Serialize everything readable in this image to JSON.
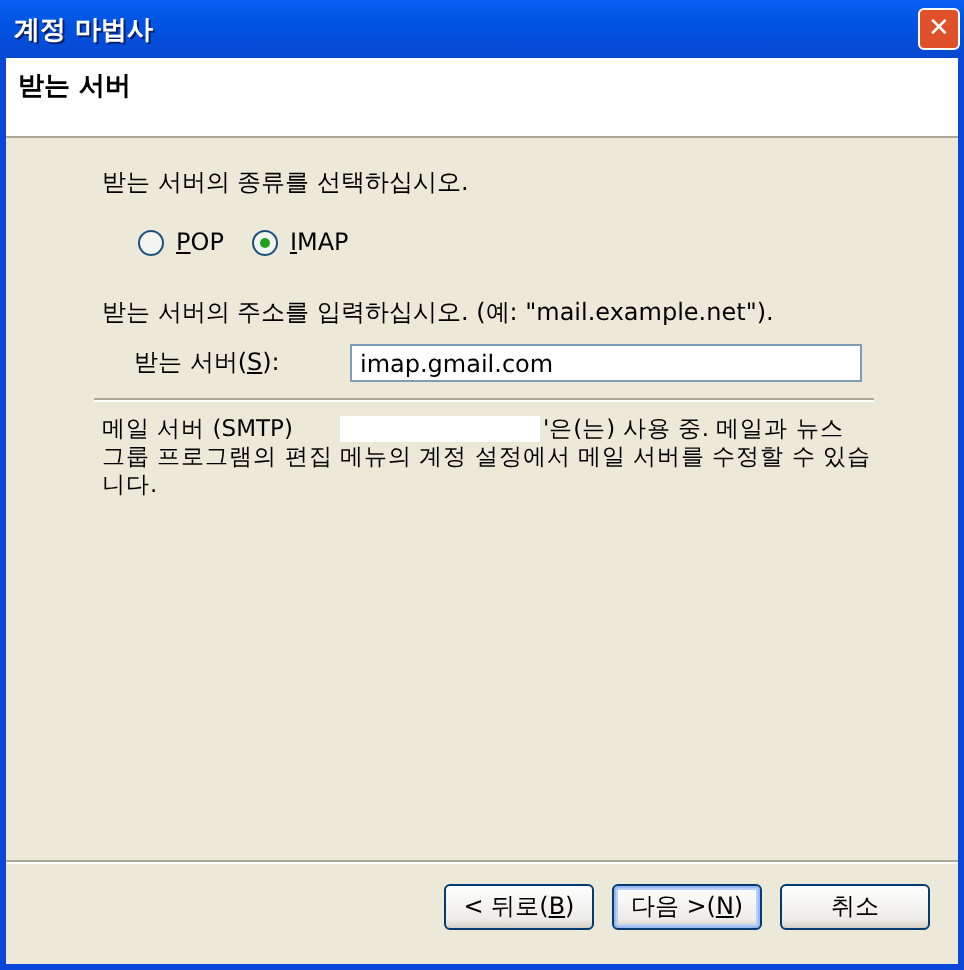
{
  "window": {
    "title": "계정 마법사",
    "close_glyph": "✕"
  },
  "header": {
    "title": "받는 서버"
  },
  "server_type": {
    "prompt": "받는 서버의 종류를 선택하십시오.",
    "options": [
      {
        "access_key": "P",
        "label_after": "OP",
        "selected": false
      },
      {
        "access_key": "I",
        "label_after": "MAP",
        "selected": true
      }
    ]
  },
  "server_address": {
    "prompt": "받는 서버의 주소를 입력하십시오. (예: \"mail.example.net\").",
    "label_before": "받는 서버(",
    "access_key": "S",
    "label_after": "):",
    "value": "imap.gmail.com"
  },
  "info": {
    "before": "메일 서버 (SMTP)",
    "redacted": true,
    "after": "'은(는) 사용 중. 메일과 뉴스",
    "rest": "그룹 프로그램의 편집 메뉴의 계정 설정에서 메일 서버를 수정할 수 있습니다."
  },
  "buttons": [
    {
      "label_before": "< 뒤로(",
      "access_key": "B",
      "label_after": ")",
      "default": false
    },
    {
      "label_before": "다음 >(",
      "access_key": "N",
      "label_after": ")",
      "default": true
    },
    {
      "label_before": "취소",
      "default": false
    }
  ]
}
